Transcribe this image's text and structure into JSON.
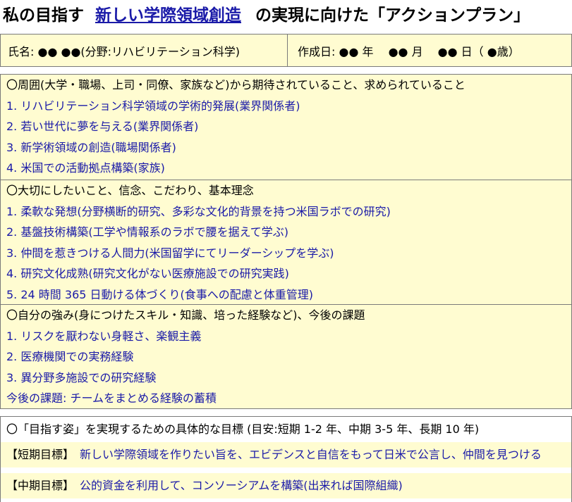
{
  "title": {
    "prefix": "私の目指す",
    "highlight": "新しい学際領域創造",
    "suffix": "の実現に向けた「アクションプラン」"
  },
  "header": {
    "name_line": "氏名: ●● ●●(分野:リハビリテーション科学)",
    "date_line": "作成日: ●● 年　 ●● 月　 ●● 日（ ●歳）"
  },
  "sections": [
    {
      "heading": "〇周囲(大学・職場、上司・同僚、家族など)から期待されていること、求められていること",
      "items": [
        "1. リハビリテーション科学領域の学術的発展(業界関係者)",
        "2. 若い世代に夢を与える(業界関係者)",
        "3. 新学術領域の創造(職場関係者)",
        "4. 米国での活動拠点構築(家族)"
      ]
    },
    {
      "heading": "〇大切にしたいこと、信念、こだわり、基本理念",
      "items": [
        "1. 柔軟な発想(分野横断的研究、多彩な文化的背景を持つ米国ラボでの研究)",
        "2. 基盤技術構築(工学や情報系のラボで腰を据えて学ぶ)",
        "3. 仲間を惹きつける人間力(米国留学にてリーダーシップを学ぶ)",
        "4. 研究文化成熟(研究文化がない医療施設での研究実践)",
        "5. 24 時間 365 日動ける体づくり(食事への配慮と体重管理)"
      ]
    },
    {
      "heading": "〇自分の強み(身につけたスキル・知識、培った経験など)、今後の課題",
      "items": [
        "1. リスクを厭わない身軽さ、楽観主義",
        "2. 医療機関での実務経験",
        "3. 異分野多施設での研究経験",
        "今後の課題:  チームをまとめる経験の蓄積"
      ]
    }
  ],
  "goals": {
    "heading": "〇「目指す姿」を実現するための具体的な目標 (目安:短期 1-2 年、中期 3-5 年、長期 10 年)",
    "short_tag": "【短期目標】",
    "short_text": "新しい学際領域を作りたい旨を、エビデンスと自信をもって日米で公言し、仲間を見つける",
    "mid_tag": "【中期目標】",
    "mid_text": "公的資金を利用して、コンソーシアムを構築(出来れば国際組織)"
  },
  "colors": {
    "accent_blue": "#1a1aa8",
    "panel_yellow": "#fffcd1",
    "border_gray": "#7a7a7a"
  }
}
